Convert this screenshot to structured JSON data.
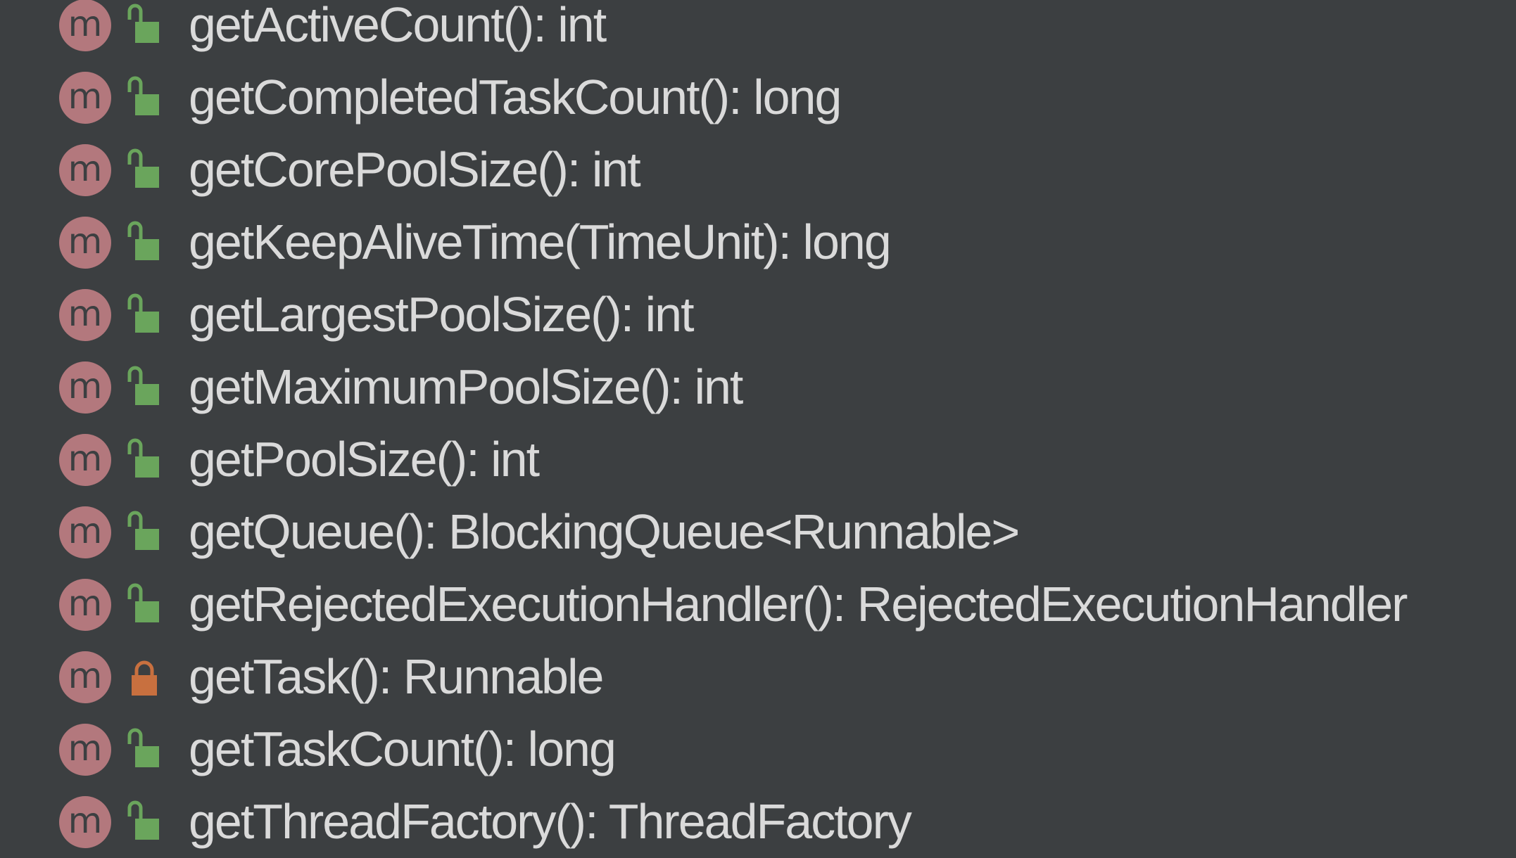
{
  "structure": {
    "method_badge_letter": "m",
    "colors": {
      "background": "#3c3f41",
      "method_badge": "#b3787d",
      "public_lock": "#6aa55c",
      "private_lock": "#c8703f",
      "text": "#dadada"
    },
    "methods": [
      {
        "signature": "getActiveCount(): int",
        "visibility": "public",
        "icon": "open-lock-icon"
      },
      {
        "signature": "getCompletedTaskCount(): long",
        "visibility": "public",
        "icon": "open-lock-icon"
      },
      {
        "signature": "getCorePoolSize(): int",
        "visibility": "public",
        "icon": "open-lock-icon"
      },
      {
        "signature": "getKeepAliveTime(TimeUnit): long",
        "visibility": "public",
        "icon": "open-lock-icon"
      },
      {
        "signature": "getLargestPoolSize(): int",
        "visibility": "public",
        "icon": "open-lock-icon"
      },
      {
        "signature": "getMaximumPoolSize(): int",
        "visibility": "public",
        "icon": "open-lock-icon"
      },
      {
        "signature": "getPoolSize(): int",
        "visibility": "public",
        "icon": "open-lock-icon"
      },
      {
        "signature": "getQueue(): BlockingQueue<Runnable>",
        "visibility": "public",
        "icon": "open-lock-icon"
      },
      {
        "signature": "getRejectedExecutionHandler(): RejectedExecutionHandler",
        "visibility": "public",
        "icon": "open-lock-icon"
      },
      {
        "signature": "getTask(): Runnable",
        "visibility": "private",
        "icon": "closed-lock-icon"
      },
      {
        "signature": "getTaskCount(): long",
        "visibility": "public",
        "icon": "open-lock-icon"
      },
      {
        "signature": "getThreadFactory(): ThreadFactory",
        "visibility": "public",
        "icon": "open-lock-icon"
      }
    ]
  }
}
